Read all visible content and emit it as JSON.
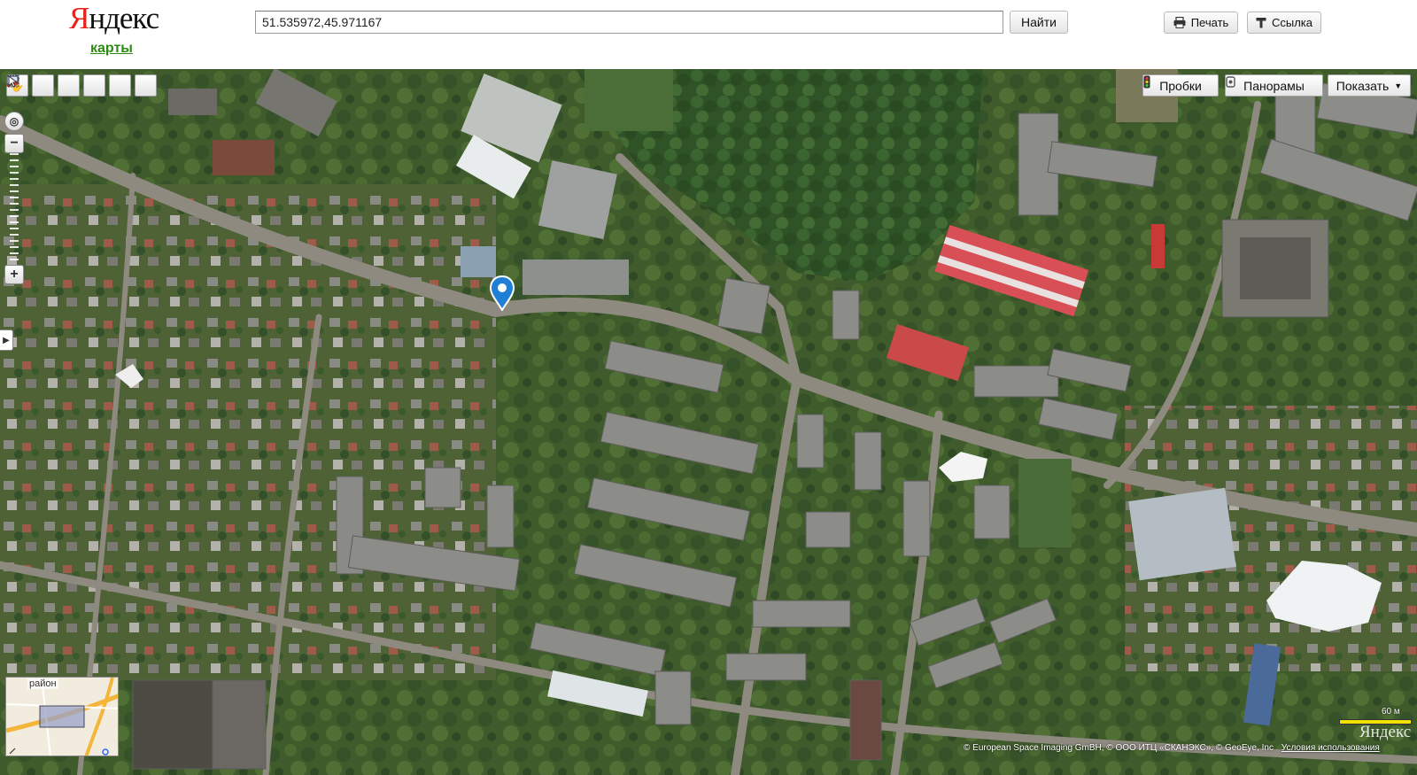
{
  "header": {
    "logo_text": "Яндекс",
    "logo_sub": "карты",
    "search_value": "51.535972,45.971167",
    "find_label": "Найти",
    "print_label": "Печать",
    "link_label": "Ссылка"
  },
  "map": {
    "layers": {
      "traffic_label": "Пробки",
      "panoramas_label": "Панорамы",
      "show_label": "Показать"
    },
    "scale_label": "60 м",
    "minimap_label": "район",
    "watermark": "Яндекс",
    "copyright": "© European Space Imaging GmBH, © ООО ИТЦ «СКАНЭКС», © GeoEye, Inc",
    "terms_label": "Условия использования",
    "marker_coords": "51.535972,45.971167"
  },
  "icons": {
    "hand": "hand-icon",
    "zoom_area": "magnifier-icon",
    "ruler": "ruler-icon",
    "route": "route-icon",
    "bookmark": "screen-icon",
    "cursor": "cursor-icon"
  },
  "colors": {
    "logo_red": "#e8211a",
    "link_green": "#2d8a12",
    "marker_blue": "#1f7fd6",
    "scale_yellow": "#f2e100"
  }
}
